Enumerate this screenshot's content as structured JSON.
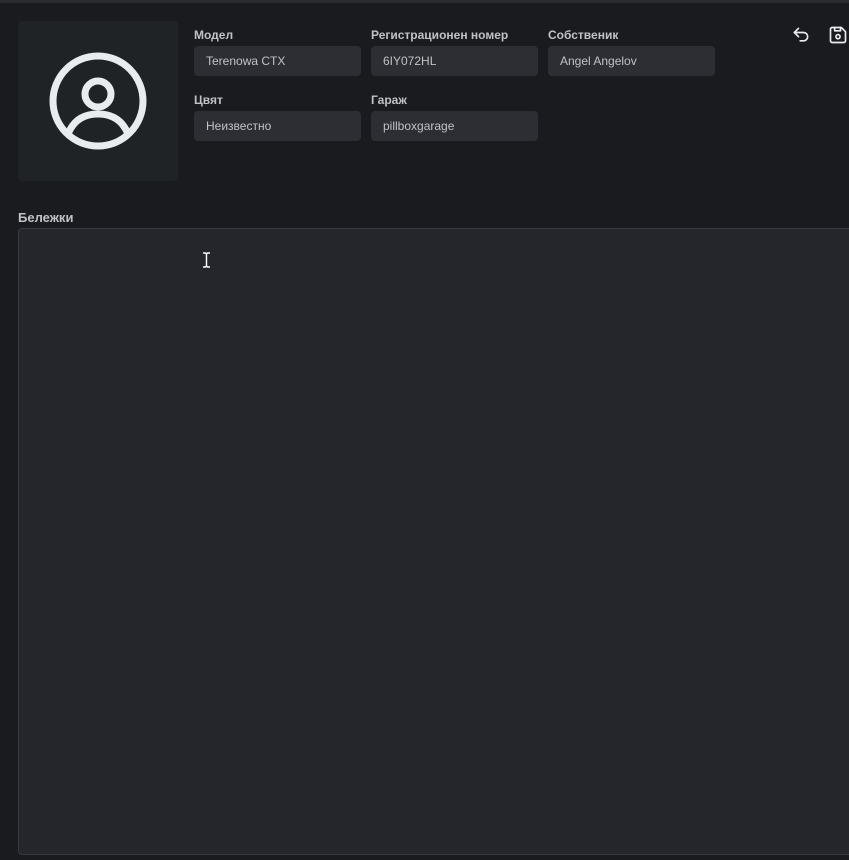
{
  "vehicle": {
    "model": {
      "label": "Модел",
      "value": "Terenowa CTX"
    },
    "plate": {
      "label": "Регистрационен номер",
      "value": "6IY072HL"
    },
    "owner": {
      "label": "Собственик",
      "value": "Angel Angelov"
    },
    "color": {
      "label": "Цвят",
      "value": "Неизвестно"
    },
    "garage": {
      "label": "Гараж",
      "value": "pillboxgarage"
    }
  },
  "toolbar": {
    "back_icon": "return-arrow-icon",
    "save_icon": "floppy-save-icon"
  },
  "avatar": {
    "icon": "user-circle-icon"
  },
  "notes": {
    "label": "Бележки",
    "value": ""
  },
  "colors": {
    "background": "#1a1b1e",
    "panel": "#202325",
    "input": "#2c2e33",
    "text": "#c1c2c5",
    "icon": "#e9ecef"
  }
}
